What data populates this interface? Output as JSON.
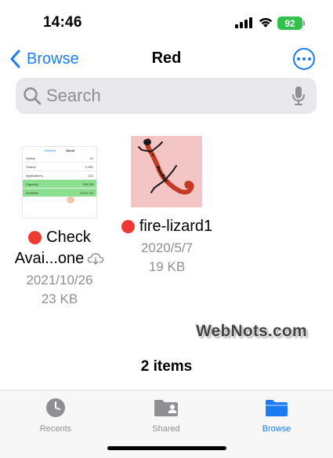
{
  "status_bar": {
    "time": "14:46",
    "battery": "92",
    "icons": [
      "signal-icon",
      "wifi-icon",
      "battery-icon"
    ]
  },
  "nav": {
    "back_label": "Browse",
    "title": "Red",
    "more_icon": "ellipsis-circle-icon"
  },
  "search": {
    "placeholder": "Search",
    "icons": [
      "search-icon",
      "mic-icon"
    ]
  },
  "files": [
    {
      "name_line1": "Check",
      "name_line2": "Avai...one",
      "tag_color": "#ee3a35",
      "date": "2021/10/26",
      "size": "23 KB",
      "cloud_icon": "cloud-download-icon",
      "thumbnail": {
        "back": "General",
        "title": "About",
        "rows": [
          {
            "label": "Videos",
            "value": "41"
          },
          {
            "label": "Photos",
            "value": "2,991"
          },
          {
            "label": "Applications",
            "value": "131"
          },
          {
            "label": "Capacity",
            "value": "256 GB"
          },
          {
            "label": "Available",
            "value": "203.6 GB"
          }
        ]
      }
    },
    {
      "name_line1": "fire-lizard1",
      "tag_color": "#ee3a35",
      "date": "2020/5/7",
      "size": "19 KB"
    }
  ],
  "watermark": "WebNots.com",
  "item_count": "2 items",
  "tabs": [
    {
      "label": "Recents",
      "icon": "clock-icon",
      "active": false
    },
    {
      "label": "Shared",
      "icon": "shared-folder-icon",
      "active": false
    },
    {
      "label": "Browse",
      "icon": "folder-icon",
      "active": true
    }
  ],
  "colors": {
    "accent": "#1a7cf0",
    "tag_red": "#ee3a35",
    "battery_green": "#30c24b"
  }
}
